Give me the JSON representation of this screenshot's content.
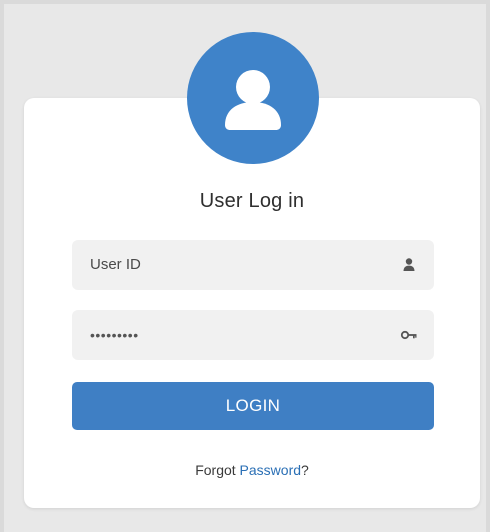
{
  "colors": {
    "accent": "#3f83c9",
    "button": "#3f7fc4",
    "link": "#2a6fb5",
    "card": "#ffffff",
    "field": "#f1f1f1"
  },
  "header": {
    "avatar_icon": "user-avatar-icon",
    "title": "User Log in"
  },
  "form": {
    "user_id": {
      "value": "User ID",
      "icon": "user-icon"
    },
    "password": {
      "value": "•••••••••",
      "icon": "key-icon"
    },
    "login_label": "LOGIN"
  },
  "footer": {
    "forgot_prefix": "Forgot ",
    "forgot_link": "Password",
    "forgot_suffix": "?"
  }
}
